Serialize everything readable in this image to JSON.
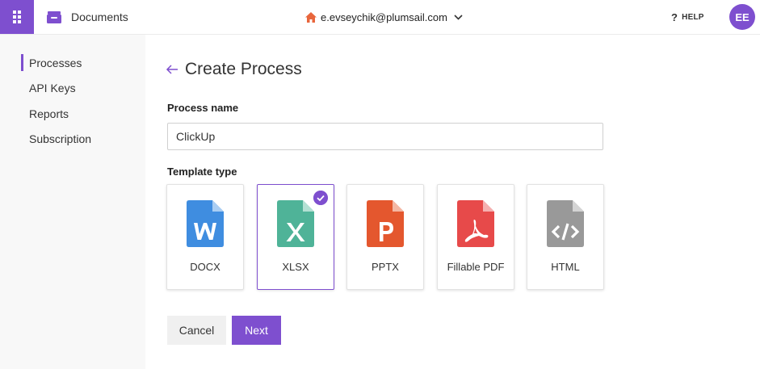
{
  "header": {
    "app_title": "Documents",
    "account_email": "e.evseychik@plumsail.com",
    "help_label": "HELP",
    "help_icon": "?",
    "avatar_initials": "EE",
    "accent_color": "#7e4fcf",
    "home_icon_color": "#e8663c"
  },
  "sidebar": {
    "items": [
      {
        "label": "Processes",
        "active": true
      },
      {
        "label": "API Keys",
        "active": false
      },
      {
        "label": "Reports",
        "active": false
      },
      {
        "label": "Subscription",
        "active": false
      }
    ]
  },
  "main": {
    "title": "Create Process",
    "process_name_label": "Process name",
    "process_name_value": "ClickUp",
    "template_type_label": "Template type",
    "templates": [
      {
        "label": "DOCX",
        "icon": "word-file-icon",
        "color": "#3f8de0",
        "selected": false
      },
      {
        "label": "XLSX",
        "icon": "excel-file-icon",
        "color": "#4fb398",
        "selected": true
      },
      {
        "label": "PPTX",
        "icon": "powerpoint-file-icon",
        "color": "#e4572e",
        "selected": false
      },
      {
        "label": "Fillable PDF",
        "icon": "pdf-file-icon",
        "color": "#e74a4a",
        "selected": false
      },
      {
        "label": "HTML",
        "icon": "html-file-icon",
        "color": "#999999",
        "selected": false
      }
    ],
    "cancel_label": "Cancel",
    "next_label": "Next"
  }
}
